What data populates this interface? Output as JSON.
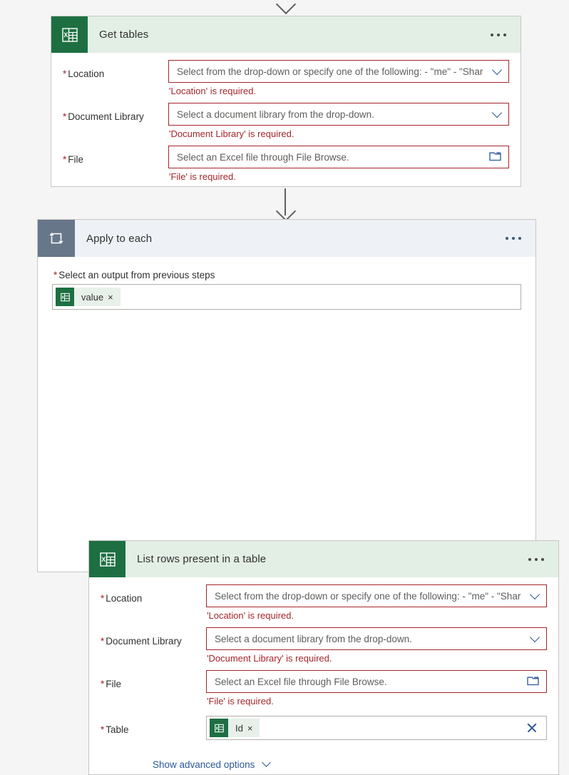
{
  "canvas": {
    "background_color": "#f5f5f5",
    "accent_blue": "#2b579a",
    "error_red": "#a4262c",
    "excel_green": "#1d6f42",
    "loop_gray": "#68768a"
  },
  "connectors": [
    {
      "name": "arrow-into-get-tables"
    },
    {
      "name": "arrow-get-tables-to-apply-to-each"
    }
  ],
  "get_tables_card": {
    "icon": "excel-icon",
    "title": "Get tables",
    "menu_label": "more-commands",
    "fields": [
      {
        "label": "Location",
        "required": true,
        "placeholder": "Select from the drop-down or specify one of the following: - \"me\" - \"Shar",
        "control": "dropdown",
        "error": "'Location' is required.",
        "invalid": true
      },
      {
        "label": "Document Library",
        "required": true,
        "placeholder": "Select a document library from the drop-down.",
        "control": "dropdown",
        "error": "'Document Library' is required.",
        "invalid": true
      },
      {
        "label": "File",
        "required": true,
        "placeholder": "Select an Excel file through File Browse.",
        "control": "filepicker",
        "error": "'File' is required.",
        "invalid": true
      }
    ]
  },
  "apply_to_each": {
    "icon": "loop-icon",
    "title": "Apply to each",
    "menu_label": "more-commands",
    "output_field": {
      "label": "Select an output from previous steps",
      "required": true,
      "token": {
        "icon": "excel-icon",
        "label": "value",
        "remove": "×"
      }
    }
  },
  "list_rows_card": {
    "icon": "excel-icon",
    "title": "List rows present in a table",
    "menu_label": "more-commands",
    "fields": [
      {
        "label": "Location",
        "required": true,
        "placeholder": "Select from the drop-down or specify one of the following: - \"me\" - \"Shar",
        "control": "dropdown",
        "error": "'Location' is required.",
        "invalid": true
      },
      {
        "label": "Document Library",
        "required": true,
        "placeholder": "Select a document library from the drop-down.",
        "control": "dropdown",
        "error": "'Document Library' is required.",
        "invalid": true
      },
      {
        "label": "File",
        "required": true,
        "placeholder": "Select an Excel file through File Browse.",
        "control": "filepicker",
        "error": "'File' is required.",
        "invalid": true
      },
      {
        "label": "Table",
        "required": true,
        "control": "token",
        "token": {
          "icon": "excel-icon",
          "label": "Id",
          "remove": "×"
        },
        "clear": "clear-icon",
        "invalid": false
      }
    ],
    "advanced_options_label": "Show advanced options"
  }
}
